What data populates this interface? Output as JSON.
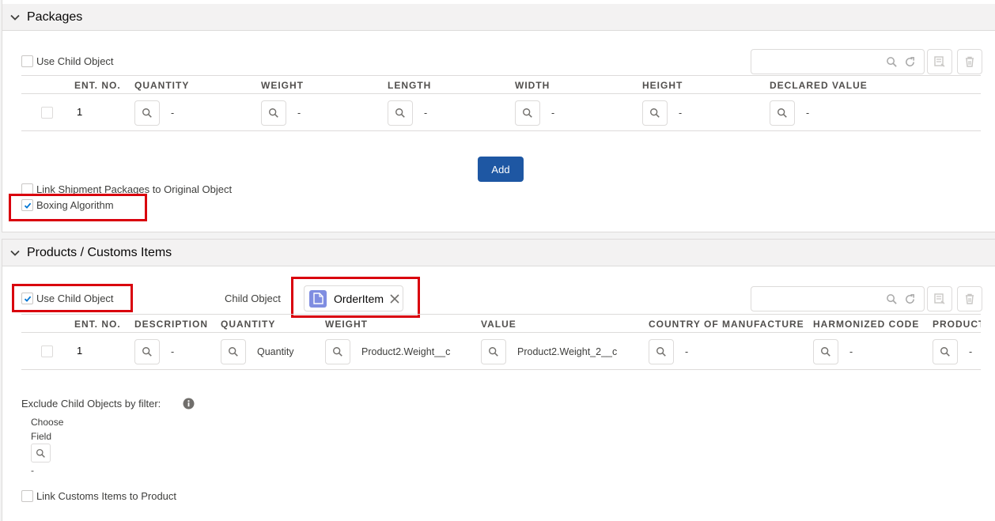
{
  "packages": {
    "title": "Packages",
    "use_child_object": "Use Child Object",
    "columns": [
      "ENT. NO.",
      "QUANTITY",
      "WEIGHT",
      "LENGTH",
      "WIDTH",
      "HEIGHT",
      "DECLARED VALUE"
    ],
    "row": {
      "ent_no": "1",
      "values": [
        "-",
        "-",
        "-",
        "-",
        "-",
        "-"
      ]
    },
    "add_label": "Add",
    "link_packages_label": "Link Shipment Packages to Original Object",
    "boxing_label": "Boxing Algorithm",
    "boxing_checked": true
  },
  "products": {
    "title": "Products / Customs Items",
    "use_child_object": "Use Child Object",
    "use_child_checked": true,
    "child_object_label": "Child Object",
    "child_object_value": "OrderItem",
    "columns": [
      "ENT. NO.",
      "DESCRIPTION",
      "QUANTITY",
      "WEIGHT",
      "VALUE",
      "COUNTRY OF MANUFACTURE",
      "HARMONIZED CODE",
      "PRODUCT"
    ],
    "row": {
      "ent_no": "1",
      "values": [
        "-",
        "Quantity",
        "Product2.Weight__c",
        "Product2.Weight_2__c",
        "-",
        "-",
        "-"
      ]
    },
    "exclude_label": "Exclude Child Objects by filter:",
    "choose_field": "Choose Field",
    "choose_field_value": "-",
    "link_customs_label": "Link Customs Items to Product"
  },
  "colors": {
    "brand_button": "#1e57a3",
    "highlight": "#d9000d",
    "object_icon": "#7f8de1"
  }
}
